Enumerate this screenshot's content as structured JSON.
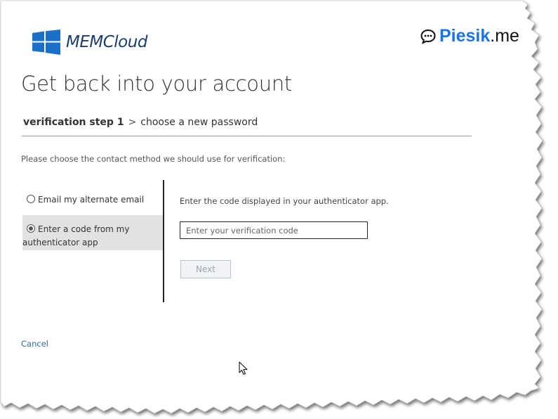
{
  "logo": {
    "text": "MEMCloud",
    "icon": "windows-logo-icon",
    "color": "#1b3e6e"
  },
  "brand": {
    "icon": "chat-bubble-icon",
    "name_bold": "Piesik",
    "name_suffix": ".me",
    "accent": "#1a74e8"
  },
  "page": {
    "title": "Get back into your account"
  },
  "steps": {
    "current": "verification step 1",
    "separator": ">",
    "next": "choose a new password"
  },
  "prompt": "Please choose the contact method we should use for verification:",
  "methods": [
    {
      "label": "Email my alternate email",
      "selected": false
    },
    {
      "label_line1": "Enter a code from my",
      "label_line2": "authenticator app",
      "selected": true
    }
  ],
  "verify": {
    "instruction": "Enter the code displayed in your authenticator app.",
    "input_placeholder": "Enter your verification code",
    "input_value": "",
    "next_label": "Next",
    "next_enabled": false
  },
  "cancel_label": "Cancel",
  "cursor_icon": "mouse-pointer-icon"
}
